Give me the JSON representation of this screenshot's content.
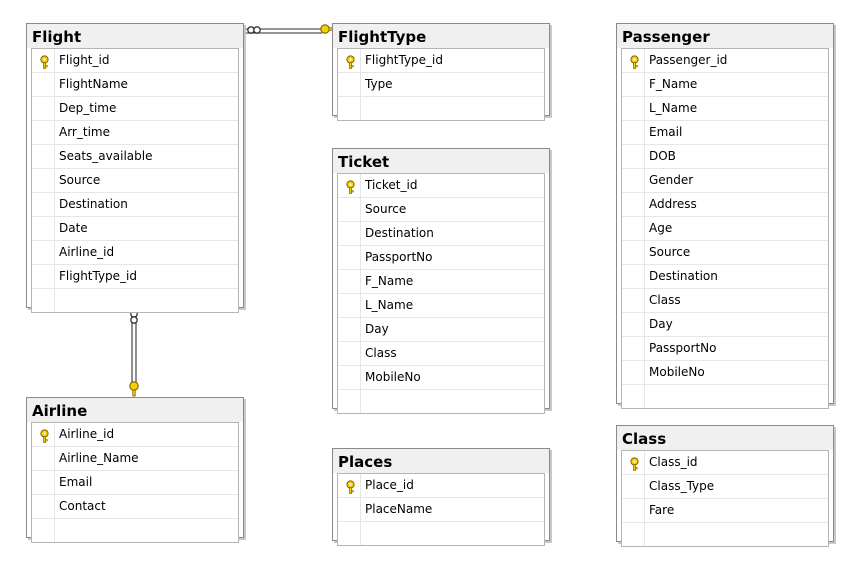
{
  "tables": {
    "flight": {
      "name": "Flight",
      "columns": [
        {
          "name": "Flight_id",
          "pk": true
        },
        {
          "name": "FlightName",
          "pk": false
        },
        {
          "name": "Dep_time",
          "pk": false
        },
        {
          "name": "Arr_time",
          "pk": false
        },
        {
          "name": "Seats_available",
          "pk": false
        },
        {
          "name": "Source",
          "pk": false
        },
        {
          "name": "Destination",
          "pk": false
        },
        {
          "name": "Date",
          "pk": false
        },
        {
          "name": "Airline_id",
          "pk": false
        },
        {
          "name": "FlightType_id",
          "pk": false
        }
      ]
    },
    "flighttype": {
      "name": "FlightType",
      "columns": [
        {
          "name": "FlightType_id",
          "pk": true
        },
        {
          "name": "Type",
          "pk": false
        }
      ]
    },
    "passenger": {
      "name": "Passenger",
      "columns": [
        {
          "name": "Passenger_id",
          "pk": true
        },
        {
          "name": "F_Name",
          "pk": false
        },
        {
          "name": "L_Name",
          "pk": false
        },
        {
          "name": "Email",
          "pk": false
        },
        {
          "name": "DOB",
          "pk": false
        },
        {
          "name": "Gender",
          "pk": false
        },
        {
          "name": "Address",
          "pk": false
        },
        {
          "name": "Age",
          "pk": false
        },
        {
          "name": "Source",
          "pk": false
        },
        {
          "name": "Destination",
          "pk": false
        },
        {
          "name": "Class",
          "pk": false
        },
        {
          "name": "Day",
          "pk": false
        },
        {
          "name": "PassportNo",
          "pk": false
        },
        {
          "name": "MobileNo",
          "pk": false
        }
      ]
    },
    "ticket": {
      "name": "Ticket",
      "columns": [
        {
          "name": "Ticket_id",
          "pk": true
        },
        {
          "name": "Source",
          "pk": false
        },
        {
          "name": "Destination",
          "pk": false
        },
        {
          "name": "PassportNo",
          "pk": false
        },
        {
          "name": "F_Name",
          "pk": false
        },
        {
          "name": "L_Name",
          "pk": false
        },
        {
          "name": "Day",
          "pk": false
        },
        {
          "name": "Class",
          "pk": false
        },
        {
          "name": "MobileNo",
          "pk": false
        }
      ]
    },
    "airline": {
      "name": "Airline",
      "columns": [
        {
          "name": "Airline_id",
          "pk": true
        },
        {
          "name": "Airline_Name",
          "pk": false
        },
        {
          "name": "Email",
          "pk": false
        },
        {
          "name": "Contact",
          "pk": false
        }
      ]
    },
    "places": {
      "name": "Places",
      "columns": [
        {
          "name": "Place_id",
          "pk": true
        },
        {
          "name": "PlaceName",
          "pk": false
        }
      ]
    },
    "class": {
      "name": "Class",
      "columns": [
        {
          "name": "Class_id",
          "pk": true
        },
        {
          "name": "Class_Type",
          "pk": false
        },
        {
          "name": "Fare",
          "pk": false
        }
      ]
    }
  },
  "relationships": [
    {
      "from": "flight",
      "to": "flighttype",
      "from_end": "many",
      "to_end": "one"
    },
    {
      "from": "flight",
      "to": "airline",
      "from_end": "many",
      "to_end": "one"
    }
  ],
  "colors": {
    "header_bg": "#f0f0f0",
    "border": "#8a8a8a",
    "key_fill": "#f5d000",
    "connector": "#555555"
  },
  "icons": {
    "primary_key": "key-icon",
    "many_end": "infinity-icon",
    "one_end": "key-icon"
  }
}
